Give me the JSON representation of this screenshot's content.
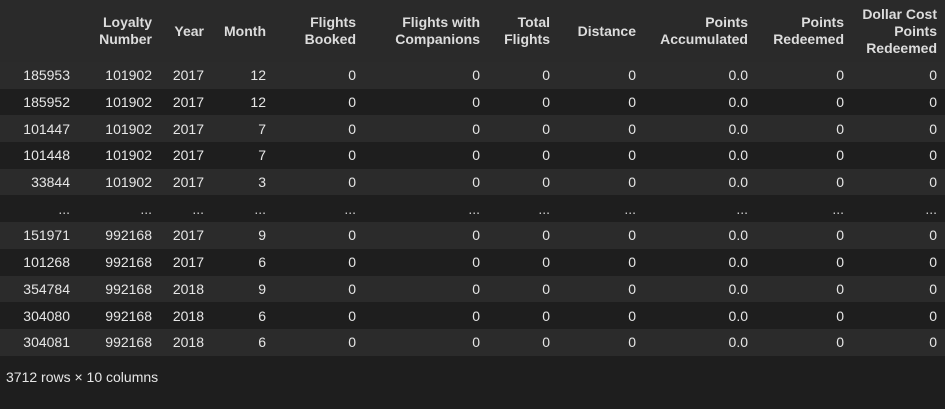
{
  "table": {
    "index_header": "",
    "columns": [
      "Loyalty Number",
      "Year",
      "Month",
      "Flights Booked",
      "Flights with Companions",
      "Total Flights",
      "Distance",
      "Points Accumulated",
      "Points Redeemed",
      "Dollar Cost Points Redeemed"
    ],
    "rows": [
      [
        "185953",
        "101902",
        "2017",
        "12",
        "0",
        "0",
        "0",
        "0",
        "0.0",
        "0",
        "0"
      ],
      [
        "185952",
        "101902",
        "2017",
        "12",
        "0",
        "0",
        "0",
        "0",
        "0.0",
        "0",
        "0"
      ],
      [
        "101447",
        "101902",
        "2017",
        "7",
        "0",
        "0",
        "0",
        "0",
        "0.0",
        "0",
        "0"
      ],
      [
        "101448",
        "101902",
        "2017",
        "7",
        "0",
        "0",
        "0",
        "0",
        "0.0",
        "0",
        "0"
      ],
      [
        "33844",
        "101902",
        "2017",
        "3",
        "0",
        "0",
        "0",
        "0",
        "0.0",
        "0",
        "0"
      ],
      [
        "...",
        "...",
        "...",
        "...",
        "...",
        "...",
        "...",
        "...",
        "...",
        "...",
        "..."
      ],
      [
        "151971",
        "992168",
        "2017",
        "9",
        "0",
        "0",
        "0",
        "0",
        "0.0",
        "0",
        "0"
      ],
      [
        "101268",
        "992168",
        "2017",
        "6",
        "0",
        "0",
        "0",
        "0",
        "0.0",
        "0",
        "0"
      ],
      [
        "354784",
        "992168",
        "2018",
        "9",
        "0",
        "0",
        "0",
        "0",
        "0.0",
        "0",
        "0"
      ],
      [
        "304080",
        "992168",
        "2018",
        "6",
        "0",
        "0",
        "0",
        "0",
        "0.0",
        "0",
        "0"
      ],
      [
        "304081",
        "992168",
        "2018",
        "6",
        "0",
        "0",
        "0",
        "0",
        "0.0",
        "0",
        "0"
      ]
    ]
  },
  "shape_text": "3712 rows × 10 columns",
  "colors": {
    "background": "#1e1e1e",
    "header_background": "#2a2a2a",
    "row_stripe": "#2b2b2b",
    "text": "#e6e6e6"
  }
}
